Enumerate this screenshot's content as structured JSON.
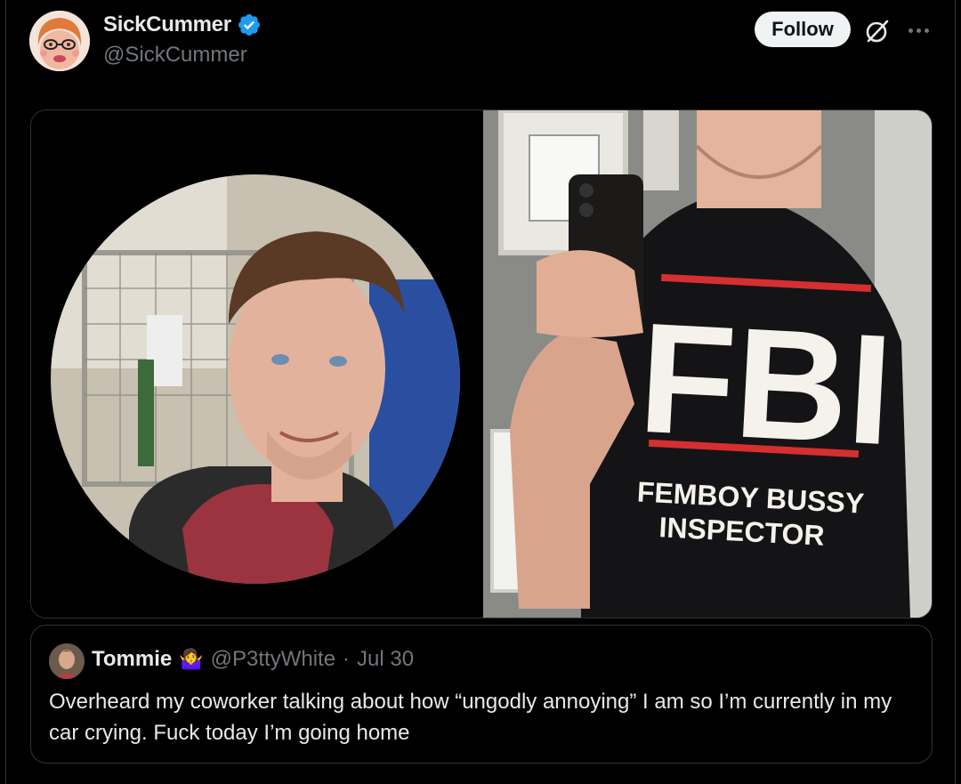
{
  "author": {
    "display_name": "SickCummer",
    "handle": "@SickCummer",
    "verified": true,
    "avatar": "cartoon-avatar"
  },
  "actions": {
    "follow_label": "Follow",
    "grok_icon": "grok-icon",
    "more_icon": "more-icon"
  },
  "media": {
    "images": [
      {
        "description": "man-portrait"
      },
      {
        "description": "mirror-selfie"
      }
    ],
    "shirt_text": {
      "big": "FBI",
      "line1": "FEMBOY BUSSY",
      "line2": "INSPECTOR"
    }
  },
  "quote": {
    "display_name": "Tommie",
    "emoji": "🤷‍♀️",
    "handle": "@P3ttyWhite",
    "separator": "·",
    "date": "Jul 30",
    "text": "Overheard my coworker talking about how “ungodly annoying” I am so I’m currently in my car crying. Fuck today I’m going home"
  },
  "colors": {
    "background": "#000000",
    "text": "#e7e9ea",
    "muted": "#71767b",
    "border": "#2f3336",
    "verified": "#1d9bf0",
    "follow_bg": "#eff3f4"
  }
}
